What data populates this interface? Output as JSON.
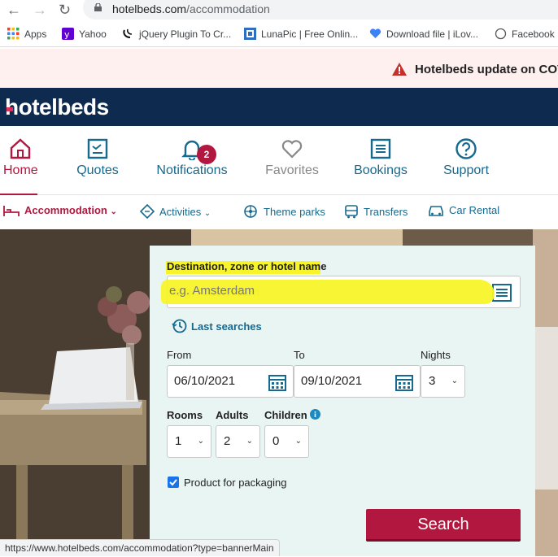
{
  "browser": {
    "url_host": "hotelbeds.com",
    "url_path": "/accommodation",
    "bookmarks": [
      "Apps",
      "Yahoo",
      "jQuery Plugin To Cr...",
      "LunaPic | Free Onlin...",
      "Download file | iLov...",
      "Facebook"
    ],
    "status_url": "https://www.hotelbeds.com/accommodation?type=bannerMain"
  },
  "banner": {
    "text": "Hotelbeds update on COV"
  },
  "header": {
    "logo": "hotelbeds"
  },
  "main_nav": [
    {
      "label": "Home"
    },
    {
      "label": "Quotes"
    },
    {
      "label": "Notifications"
    },
    {
      "label": "Favorites"
    },
    {
      "label": "Bookings"
    },
    {
      "label": "Support"
    }
  ],
  "notification_count": "2",
  "sub_nav": [
    "Accommodation",
    "Activities",
    "Theme parks",
    "Transfers",
    "Car Rental"
  ],
  "form": {
    "destination_label": "Destination, zone or hotel name",
    "destination_placeholder": "e.g. Amsterdam",
    "last_searches": "Last searches",
    "from_label": "From",
    "to_label": "To",
    "nights_label": "Nights",
    "from_value": "06/10/2021",
    "to_value": "09/10/2021",
    "nights_value": "3",
    "rooms_label": "Rooms",
    "adults_label": "Adults",
    "children_label": "Children",
    "rooms_value": "1",
    "adults_value": "2",
    "children_value": "0",
    "packaging_label": "Product for packaging",
    "search_label": "Search"
  },
  "colors": {
    "brand_navy": "#0e2a4e",
    "accent_red": "#b2173f",
    "link_teal": "#16698f",
    "highlight_yellow": "#f8f42a"
  }
}
